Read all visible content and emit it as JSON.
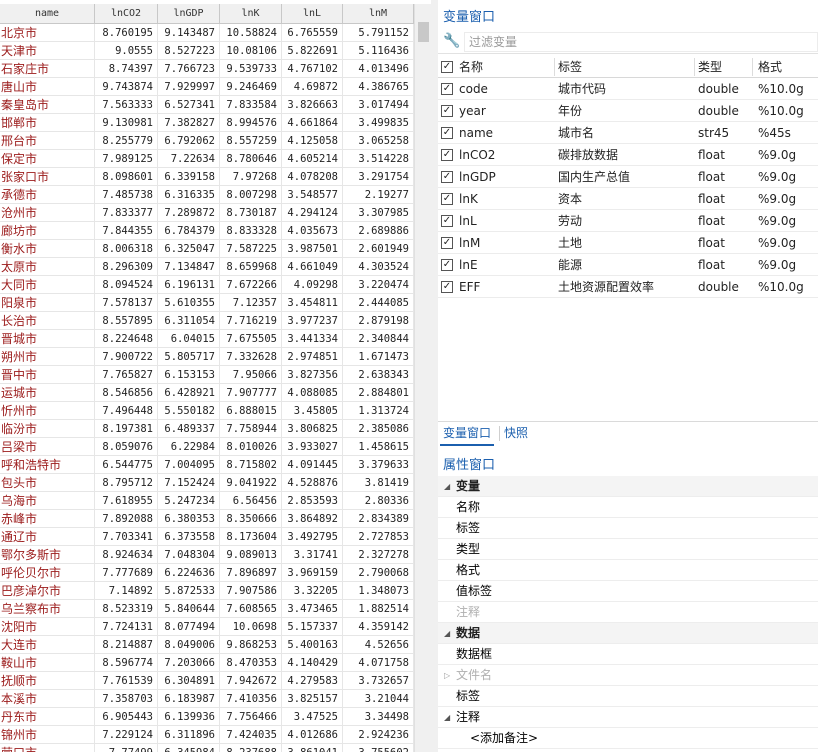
{
  "grid": {
    "columns": [
      "name",
      "lnCO2",
      "lnGDP",
      "lnK",
      "lnL",
      "lnM"
    ],
    "rows": [
      [
        "北京市",
        "8.760195",
        "9.143487",
        "10.58824",
        "6.765559",
        "5.791152"
      ],
      [
        "天津市",
        "9.0555",
        "8.527223",
        "10.08106",
        "5.822691",
        "5.116436"
      ],
      [
        "石家庄市",
        "8.74397",
        "7.766723",
        "9.539733",
        "4.767102",
        "4.013496"
      ],
      [
        "唐山市",
        "9.743874",
        "7.929997",
        "9.246469",
        "4.69872",
        "4.386765"
      ],
      [
        "秦皇岛市",
        "7.563333",
        "6.527341",
        "7.833584",
        "3.826663",
        "3.017494"
      ],
      [
        "邯郸市",
        "9.130981",
        "7.382827",
        "8.994576",
        "4.661864",
        "3.499835"
      ],
      [
        "邢台市",
        "8.255779",
        "6.792062",
        "8.557259",
        "4.125058",
        "3.065258"
      ],
      [
        "保定市",
        "7.989125",
        "7.22634",
        "8.780646",
        "4.605214",
        "3.514228"
      ],
      [
        "张家口市",
        "8.098601",
        "6.339158",
        "7.97268",
        "4.078208",
        "3.291754"
      ],
      [
        "承德市",
        "7.485738",
        "6.316335",
        "8.007298",
        "3.548577",
        "2.19277"
      ],
      [
        "沧州市",
        "7.833377",
        "7.289872",
        "8.730187",
        "4.294124",
        "3.307985"
      ],
      [
        "廊坊市",
        "7.844355",
        "6.784379",
        "8.833328",
        "4.035673",
        "2.689886"
      ],
      [
        "衡水市",
        "8.006318",
        "6.325047",
        "7.587225",
        "3.987501",
        "2.601949"
      ],
      [
        "太原市",
        "8.296309",
        "7.134847",
        "8.659968",
        "4.661049",
        "4.303524"
      ],
      [
        "大同市",
        "8.094524",
        "6.196131",
        "7.672266",
        "4.09298",
        "3.220474"
      ],
      [
        "阳泉市",
        "7.578137",
        "5.610355",
        "7.12357",
        "3.454811",
        "2.444085"
      ],
      [
        "长治市",
        "8.557895",
        "6.311054",
        "7.716219",
        "3.977237",
        "2.879198"
      ],
      [
        "晋城市",
        "8.224648",
        "6.04015",
        "7.675505",
        "3.441334",
        "2.340844"
      ],
      [
        "朔州市",
        "7.900722",
        "5.805717",
        "7.332628",
        "2.974851",
        "1.671473"
      ],
      [
        "晋中市",
        "7.765827",
        "6.153153",
        "7.95066",
        "3.827356",
        "2.638343"
      ],
      [
        "运城市",
        "8.546856",
        "6.428921",
        "7.907777",
        "4.088085",
        "2.884801"
      ],
      [
        "忻州市",
        "7.496448",
        "5.550182",
        "6.888015",
        "3.45805",
        "1.313724"
      ],
      [
        "临汾市",
        "8.197381",
        "6.489337",
        "7.758944",
        "3.806825",
        "2.385086"
      ],
      [
        "吕梁市",
        "8.059076",
        "6.22984",
        "8.010026",
        "3.933027",
        "1.458615"
      ],
      [
        "呼和浩特市",
        "6.544775",
        "7.004095",
        "8.715802",
        "4.091445",
        "3.379633"
      ],
      [
        "包头市",
        "8.795712",
        "7.152424",
        "9.041922",
        "4.528876",
        "3.81419"
      ],
      [
        "乌海市",
        "7.618955",
        "5.247234",
        "6.56456",
        "2.853593",
        "2.80336"
      ],
      [
        "赤峰市",
        "7.892088",
        "6.380353",
        "8.350666",
        "3.864892",
        "2.834389"
      ],
      [
        "通辽市",
        "7.703341",
        "6.373558",
        "8.173604",
        "3.492795",
        "2.727853"
      ],
      [
        "鄂尔多斯市",
        "8.924634",
        "7.048304",
        "9.089013",
        "3.31741",
        "2.327278"
      ],
      [
        "呼伦贝尔市",
        "7.777689",
        "6.224636",
        "7.896897",
        "3.969159",
        "2.790068"
      ],
      [
        "巴彦淖尔市",
        "7.14892",
        "5.872533",
        "7.907586",
        "3.32205",
        "1.348073"
      ],
      [
        "乌兰察布市",
        "8.523319",
        "5.840644",
        "7.608565",
        "3.473465",
        "1.882514"
      ],
      [
        "沈阳市",
        "7.724131",
        "8.077494",
        "10.0698",
        "5.157337",
        "4.359142"
      ],
      [
        "大连市",
        "8.214887",
        "8.049006",
        "9.868253",
        "5.400163",
        "4.52656"
      ],
      [
        "鞍山市",
        "8.596774",
        "7.203066",
        "8.470353",
        "4.140429",
        "4.071758"
      ],
      [
        "抚顺市",
        "7.761539",
        "6.304891",
        "7.942672",
        "4.279583",
        "3.732657"
      ],
      [
        "本溪市",
        "7.358703",
        "6.183987",
        "7.410356",
        "3.825157",
        "3.21044"
      ],
      [
        "丹东市",
        "6.905443",
        "6.139936",
        "7.756466",
        "3.47525",
        "3.34498"
      ],
      [
        "锦州市",
        "7.229124",
        "6.311896",
        "7.424035",
        "4.012686",
        "2.924236"
      ],
      [
        "营口市",
        "7.77499",
        "6.345984",
        "8.237688",
        "3.861041",
        "3.755602"
      ]
    ]
  },
  "variables_window": {
    "title": "变量窗口",
    "filter_placeholder": "过滤变量",
    "headers": {
      "name": "名称",
      "label": "标签",
      "type": "类型",
      "format": "格式"
    },
    "rows": [
      {
        "name": "code",
        "label": "城市代码",
        "type": "double",
        "format": "%10.0g"
      },
      {
        "name": "year",
        "label": "年份",
        "type": "double",
        "format": "%10.0g"
      },
      {
        "name": "name",
        "label": "城市名",
        "type": "str45",
        "format": "%45s"
      },
      {
        "name": "lnCO2",
        "label": "碳排放数据",
        "type": "float",
        "format": "%9.0g"
      },
      {
        "name": "lnGDP",
        "label": "国内生产总值",
        "type": "float",
        "format": "%9.0g"
      },
      {
        "name": "lnK",
        "label": "资本",
        "type": "float",
        "format": "%9.0g"
      },
      {
        "name": "lnL",
        "label": "劳动",
        "type": "float",
        "format": "%9.0g"
      },
      {
        "name": "lnM",
        "label": "土地",
        "type": "float",
        "format": "%9.0g"
      },
      {
        "name": "lnE",
        "label": "能源",
        "type": "float",
        "format": "%9.0g"
      },
      {
        "name": "EFF",
        "label": "土地资源配置效率",
        "type": "double",
        "format": "%10.0g"
      }
    ]
  },
  "tabs": {
    "variables": "变量窗口",
    "snapshots": "快照"
  },
  "properties_window": {
    "title": "属性窗口",
    "variable_group": "变量",
    "variable_props": [
      "名称",
      "标签",
      "类型",
      "格式",
      "值标签",
      "注释"
    ],
    "data_group": "数据",
    "data_props": [
      "数据框",
      "文件名",
      "标签",
      "注释"
    ],
    "add_note": "<添加备注>"
  },
  "icons": {
    "filter": "wrench-icon",
    "checkbox": "checkmark-icon",
    "group_toggle": "triangle-icon"
  },
  "colors": {
    "accent": "#1b5fae",
    "name_cell": "#9b1a1a"
  }
}
